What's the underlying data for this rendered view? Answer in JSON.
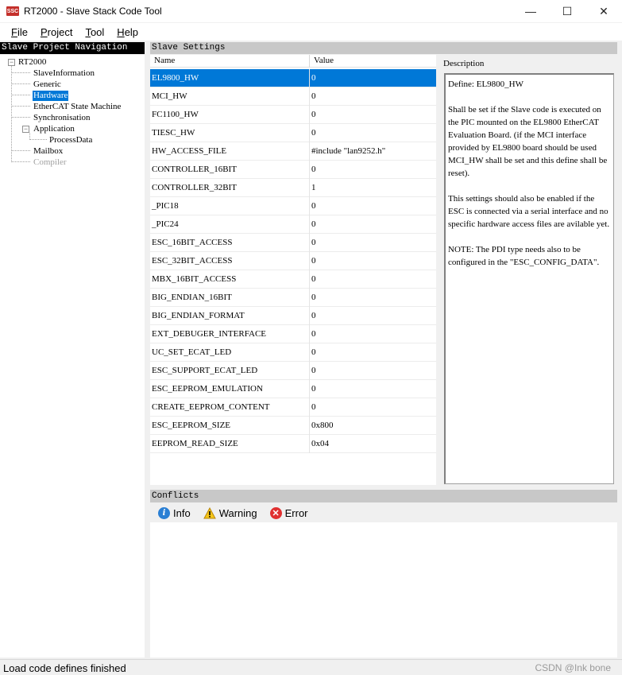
{
  "window": {
    "icon_text": "SSC",
    "title": "RT2000 - Slave Stack Code Tool",
    "minimize": "—",
    "maximize": "☐",
    "close": "✕"
  },
  "menu": [
    {
      "first": "F",
      "rest": "ile"
    },
    {
      "first": "P",
      "rest": "roject"
    },
    {
      "first": "T",
      "rest": "ool"
    },
    {
      "first": "H",
      "rest": "elp"
    }
  ],
  "nav": {
    "header": "Slave Project Navigation",
    "root": "RT2000",
    "items": {
      "slave_information": "SlaveInformation",
      "generic": "Generic",
      "hardware": "Hardware",
      "ethercat_state_machine": "EtherCAT State Machine",
      "synchronisation": "Synchronisation",
      "application": "Application",
      "process_data": "ProcessData",
      "mailbox": "Mailbox",
      "compiler": "Compiler"
    }
  },
  "settings": {
    "header": "Slave Settings",
    "col_name": "Name",
    "col_value": "Value",
    "rows": [
      {
        "name": "EL9800_HW",
        "value": "0"
      },
      {
        "name": "MCI_HW",
        "value": "0"
      },
      {
        "name": "FC1100_HW",
        "value": "0"
      },
      {
        "name": "TIESC_HW",
        "value": "0"
      },
      {
        "name": "HW_ACCESS_FILE",
        "value": "#include \"lan9252.h\""
      },
      {
        "name": "CONTROLLER_16BIT",
        "value": "0"
      },
      {
        "name": "CONTROLLER_32BIT",
        "value": "1"
      },
      {
        "name": "_PIC18",
        "value": "0"
      },
      {
        "name": "_PIC24",
        "value": "0"
      },
      {
        "name": "ESC_16BIT_ACCESS",
        "value": "0"
      },
      {
        "name": "ESC_32BIT_ACCESS",
        "value": "0"
      },
      {
        "name": "MBX_16BIT_ACCESS",
        "value": "0"
      },
      {
        "name": "BIG_ENDIAN_16BIT",
        "value": "0"
      },
      {
        "name": "BIG_ENDIAN_FORMAT",
        "value": "0"
      },
      {
        "name": "EXT_DEBUGER_INTERFACE",
        "value": "0"
      },
      {
        "name": "UC_SET_ECAT_LED",
        "value": "0"
      },
      {
        "name": "ESC_SUPPORT_ECAT_LED",
        "value": "0"
      },
      {
        "name": "ESC_EEPROM_EMULATION",
        "value": "0"
      },
      {
        "name": "CREATE_EEPROM_CONTENT",
        "value": "0"
      },
      {
        "name": "ESC_EEPROM_SIZE",
        "value": "0x800"
      },
      {
        "name": "EEPROM_READ_SIZE",
        "value": "0x04"
      }
    ]
  },
  "description": {
    "label": "Description",
    "text": "Define: EL9800_HW\n\nShall be set if the Slave code is executed on the PIC mounted on the EL9800 EtherCAT Evaluation Board. (if the MCI interface provided by EL9800 board should be used MCI_HW shall be set and this define shall be reset).\n\nThis settings should also be enabled if the ESC is connected via a serial interface and no specific hardware access files are avilable yet.\n\nNOTE: The PDI type needs also to be configured in the \"ESC_CONFIG_DATA\"."
  },
  "conflicts": {
    "header": "Conflicts",
    "info": "Info",
    "warning": "Warning",
    "error": "Error"
  },
  "status": {
    "text": "Load code defines finished",
    "watermark": "CSDN @Ink bone"
  },
  "colors": {
    "selection": "#0078d7",
    "panel_header": "#c8c8c8",
    "nav_header": "#000000"
  }
}
